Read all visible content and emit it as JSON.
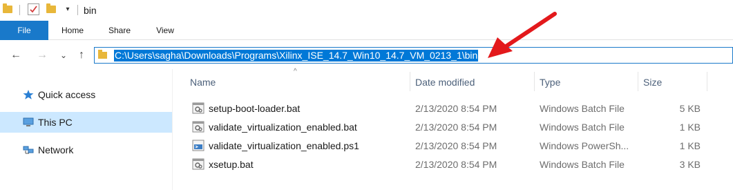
{
  "window": {
    "title": "bin"
  },
  "quick_access": {
    "folder_icon": "folder-icon",
    "properties_icon": "properties-check-icon",
    "new_folder_icon": "new-folder-icon",
    "customize_icon": "customize-dropdown-icon",
    "customize_glyph": "▾"
  },
  "ribbon": {
    "tabs": [
      {
        "label": "File",
        "active": true
      },
      {
        "label": "Home"
      },
      {
        "label": "Share"
      },
      {
        "label": "View"
      }
    ]
  },
  "navigation": {
    "back_glyph": "←",
    "forward_glyph": "→",
    "recent_glyph": "⌄",
    "up_glyph": "↑"
  },
  "address_bar": {
    "path": "C:\\Users\\sagha\\Downloads\\Programs\\Xilinx_ISE_14.7_Win10_14.7_VM_0213_1\\bin",
    "selected": true
  },
  "annotation": {
    "arrow_color": "#e3191c"
  },
  "nav_pane": {
    "items": [
      {
        "label": "Quick access",
        "icon": "star-icon"
      },
      {
        "label": "This PC",
        "icon": "computer-icon",
        "selected": true
      },
      {
        "label": "Network",
        "icon": "network-icon"
      }
    ]
  },
  "file_list": {
    "sort_glyph": "^",
    "columns": [
      "Name",
      "Date modified",
      "Type",
      "Size"
    ],
    "rows": [
      {
        "name": "setup-boot-loader.bat",
        "date": "2/13/2020 8:54 PM",
        "type": "Windows Batch File",
        "size": "5 KB",
        "icon": "batch-file-icon"
      },
      {
        "name": "validate_virtualization_enabled.bat",
        "date": "2/13/2020 8:54 PM",
        "type": "Windows Batch File",
        "size": "1 KB",
        "icon": "batch-file-icon"
      },
      {
        "name": "validate_virtualization_enabled.ps1",
        "date": "2/13/2020 8:54 PM",
        "type": "Windows PowerSh...",
        "size": "1 KB",
        "icon": "powershell-file-icon"
      },
      {
        "name": "xsetup.bat",
        "date": "2/13/2020 8:54 PM",
        "type": "Windows Batch File",
        "size": "3 KB",
        "icon": "batch-file-icon"
      }
    ]
  },
  "colors": {
    "accent": "#1979ca",
    "selection": "#0078d7",
    "nav_selected": "#cce8ff",
    "folder": "#e8b73a"
  }
}
